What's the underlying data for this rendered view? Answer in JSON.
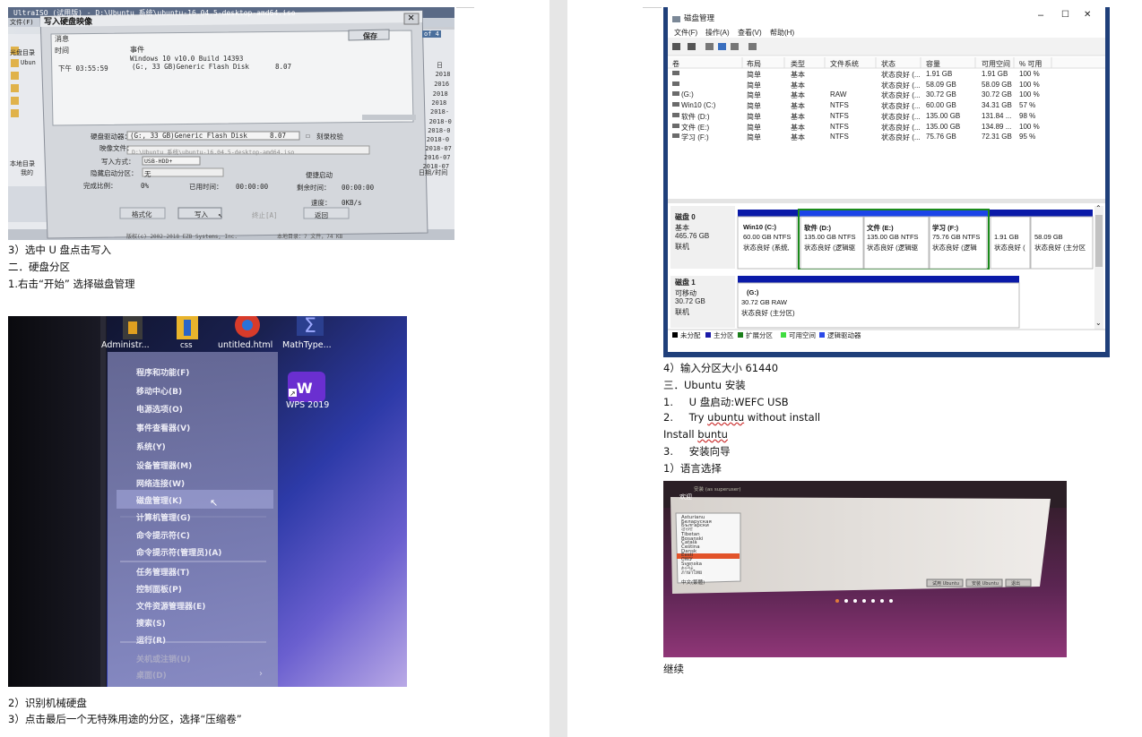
{
  "left_page": {
    "ultraiso": {
      "titlebar": "UltraISO (试用版) - D:\\Ubuntu 系统\\ubuntu-16.04.5-desktop-amd64.iso",
      "dialog_title": "写入硬盘映像",
      "log_header_message": "消息",
      "save_button": "保存",
      "log_col_time": "时间",
      "log_col_event": "事件",
      "log_line1": "Windows 10 v10.0 Build 14393",
      "log_time": "下午 03:55:59",
      "log_line2": "(G:, 33 GB)Generic Flash Disk",
      "log_line2_suffix": "8.07",
      "label_drive": "硬盘驱动器：",
      "drive_value": "(G:, 33 GB)Generic Flash Disk",
      "drive_suffix": "8.07",
      "verify_label": "刻录校验",
      "label_image": "映像文件：",
      "image_value": "D:\\Ubuntu 系统\\ubuntu-16.04.5-desktop-amd64.iso",
      "label_write_mode": "写入方式：",
      "write_mode_value": "USB-HDD+",
      "label_hide": "隐藏启动分区：",
      "hide_value": "无",
      "label_boot": "便捷启动",
      "label_progress": "完成比例：",
      "progress_value": "0%",
      "label_elapsed": "已用时间：",
      "elapsed_value": "00:00:00",
      "label_remaining": "剩余时间：",
      "remaining_value": "00:00:00",
      "label_speed": "速度：",
      "speed_value": "0KB/s",
      "btn_format": "格式化",
      "btn_write": "写入",
      "btn_stop": "终止[A]",
      "btn_back": "返回",
      "side_dates": [
        "日",
        "2018",
        "2016",
        "2018",
        "2018",
        "2018-",
        "2018-0",
        "2018-0",
        "2018-0",
        "2018-07",
        "2016-07",
        "2018-07"
      ],
      "side_date_label": "日期/时间",
      "tree_label": "本地目录",
      "tree_item": "我的",
      "menu_file": "文件(F)",
      "tab_label": "光盘目录",
      "tree_top": "Ubun",
      "size_label": "of 4",
      "status_bar": "版权(c) 2002-2018 EZB Systems, Inc.",
      "status_bar2": "本地目录：7 文件，74 KB"
    },
    "caption1": "3）选中 U 盘点击写入",
    "caption2": "二．硬盘分区",
    "caption3": "1.右击“开始”   选择磁盘管理",
    "desktop_icons": [
      "Administr...",
      "css",
      "untitled.html",
      "MathType...",
      "WPS 2019"
    ],
    "winx_menu": [
      "程序和功能(F)",
      "移动中心(B)",
      "电源选项(O)",
      "事件查看器(V)",
      "系统(Y)",
      "设备管理器(M)",
      "网络连接(W)",
      "磁盘管理(K)",
      "计算机管理(G)",
      "命令提示符(C)",
      "命令提示符(管理员)(A)",
      "任务管理器(T)",
      "控制面板(P)",
      "文件资源管理器(E)",
      "搜索(S)",
      "运行(R)",
      "关机或注销(U)",
      "桌面(D)"
    ],
    "caption4": "2）识别机械硬盘",
    "caption5": "3）点击最后一个无特殊用途的分区，选择“压缩卷”"
  },
  "right_page": {
    "disk_mgmt": {
      "title": "磁盘管理",
      "menus": [
        "文件(F)",
        "操作(A)",
        "查看(V)",
        "帮助(H)"
      ],
      "columns": [
        "卷",
        "布局",
        "类型",
        "文件系统",
        "状态",
        "容量",
        "可用空间",
        "% 可用"
      ],
      "rows": [
        [
          "",
          "简单",
          "基本",
          "",
          "状态良好 (...",
          "1.91 GB",
          "1.91 GB",
          "100 %"
        ],
        [
          "",
          "简单",
          "基本",
          "",
          "状态良好 (...",
          "58.09 GB",
          "58.09 GB",
          "100 %"
        ],
        [
          "(G:)",
          "简单",
          "基本",
          "RAW",
          "状态良好 (...",
          "30.72 GB",
          "30.72 GB",
          "100 %"
        ],
        [
          "Win10 (C:)",
          "简单",
          "基本",
          "NTFS",
          "状态良好 (...",
          "60.00 GB",
          "34.31 GB",
          "57 %"
        ],
        [
          "软件 (D:)",
          "简单",
          "基本",
          "NTFS",
          "状态良好 (...",
          "135.00 GB",
          "131.84 ...",
          "98 %"
        ],
        [
          "文件 (E:)",
          "简单",
          "基本",
          "NTFS",
          "状态良好 (...",
          "135.00 GB",
          "134.89 ...",
          "100 %"
        ],
        [
          "学习 (F:)",
          "简单",
          "基本",
          "NTFS",
          "状态良好 (...",
          "75.76 GB",
          "72.31 GB",
          "95 %"
        ]
      ],
      "disk0": {
        "name": "磁盘 0",
        "type": "基本",
        "size": "465.76 GB",
        "state": "联机",
        "volumes": [
          {
            "name": "Win10  (C:)",
            "size": "60.00 GB NTFS",
            "status": "状态良好 (系统,"
          },
          {
            "name": "软件  (D:)",
            "size": "135.00 GB NTFS",
            "status": "状态良好 (逻辑驱"
          },
          {
            "name": "文件  (E:)",
            "size": "135.00 GB NTFS",
            "status": "状态良好 (逻辑驱"
          },
          {
            "name": "学习  (F:)",
            "size": "75.76 GB NTFS",
            "status": "状态良好 (逻辑"
          },
          {
            "name": "",
            "size": "1.91 GB",
            "status": "状态良好 ("
          },
          {
            "name": "",
            "size": "58.09 GB",
            "status": "状态良好 (主分区"
          }
        ]
      },
      "disk1": {
        "name": "磁盘 1",
        "type": "可移动",
        "size": "30.72 GB",
        "state": "联机",
        "volume": {
          "name": "(G:)",
          "size": "30.72 GB RAW",
          "status": "状态良好 (主分区)"
        }
      },
      "legend": [
        "未分配",
        "主分区",
        "扩展分区",
        "可用空间",
        "逻辑驱动器"
      ],
      "legend_colors": [
        "#000000",
        "#1a1aa8",
        "#1b7f1b",
        "#3fdc3f",
        "#2b49e8"
      ]
    },
    "caption1": "4）输入分区大小 61440",
    "caption2": "三．Ubuntu  安装",
    "caption3_num": "1.",
    "caption3": "U 盘启动:WEFC USB",
    "caption4_num": "2.",
    "caption4_a": "Try ",
    "caption4_b": "ubuntu",
    "caption4_c": " without install",
    "caption5_a": "Install ",
    "caption5_b": "buntu",
    "caption6_num": "3.",
    "caption6": "安装向导",
    "caption7": "1）语言选择",
    "ubuntu": {
      "top_label": "安装 (as superuser)",
      "welcome": "欢迎",
      "languages": [
        "Asturianu",
        "Беларуская",
        "Български",
        "বাংলা",
        "Tibetan",
        "Bosanski",
        "Català",
        "Čeština",
        "Dansk",
        "Eesti",
        "ᏣᎳᎩ",
        "Svenska",
        "தமிழ்",
        "ภาษาไทย",
        "中文(简体)",
        "中文(繁體)"
      ],
      "btn_try": "试用 Ubuntu",
      "btn_install": "安装 Ubuntu",
      "btn_quit": "退出"
    },
    "caption8": "继续"
  }
}
